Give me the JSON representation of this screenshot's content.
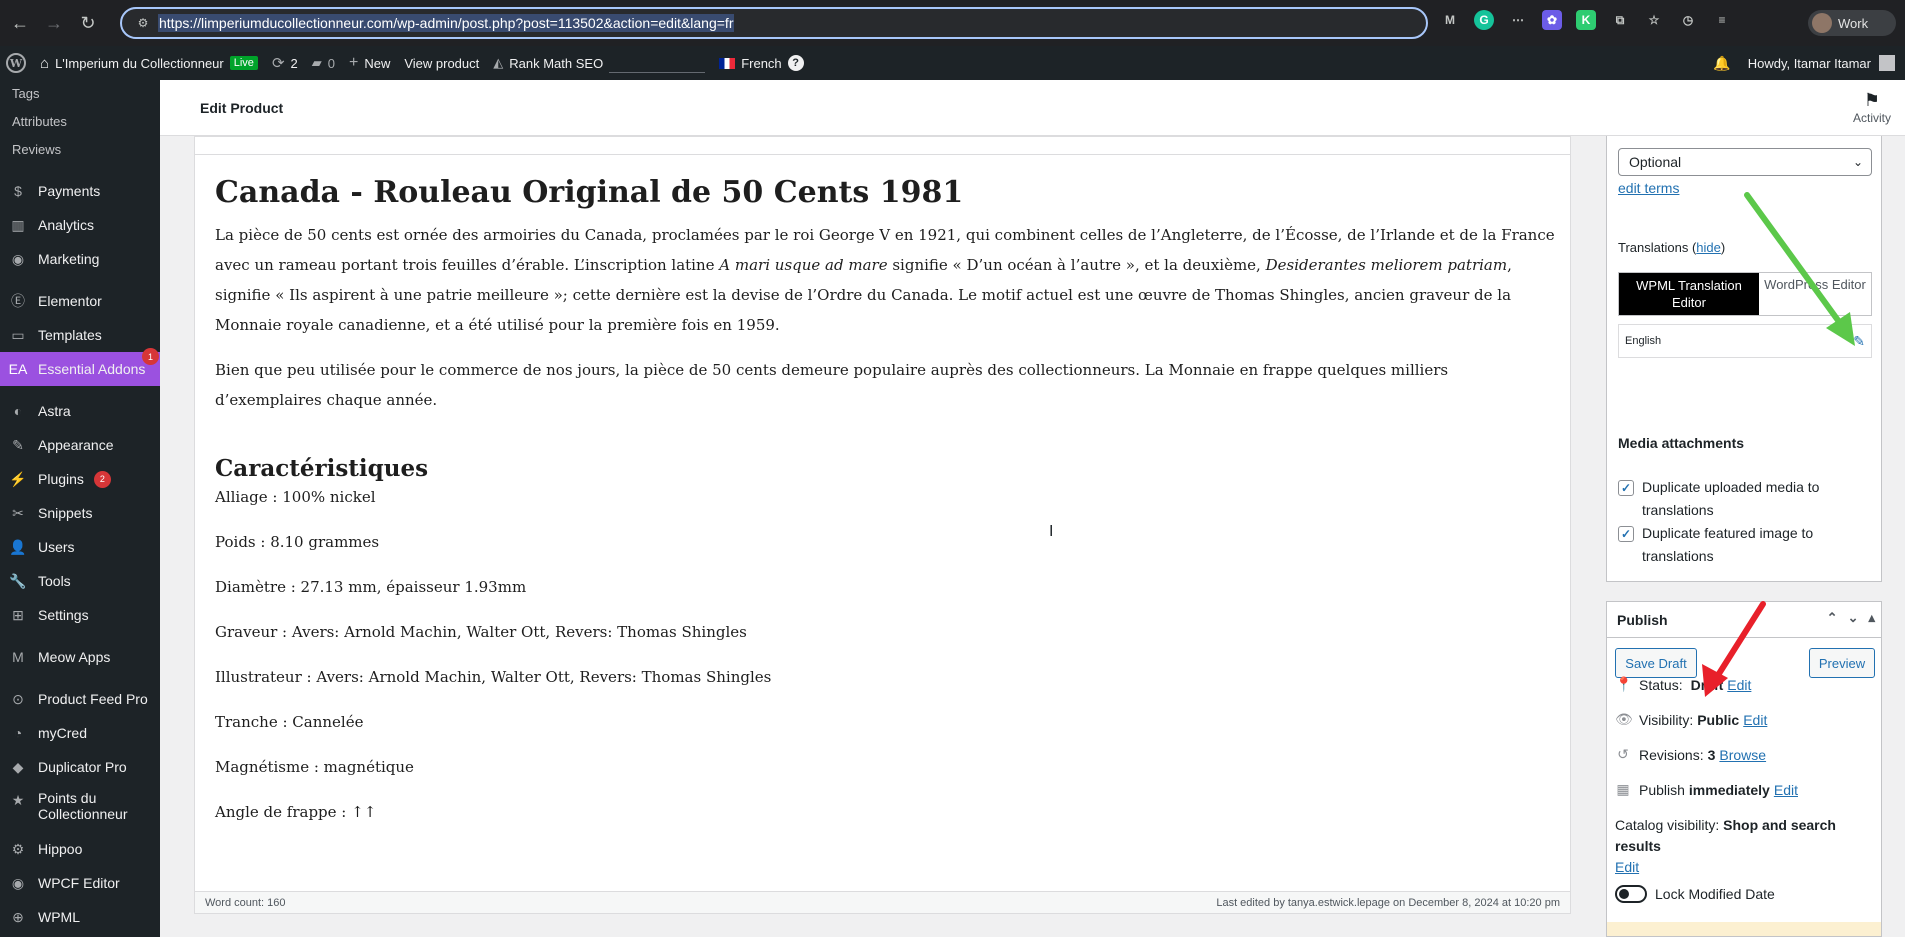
{
  "browser": {
    "url": "https://limperiumducollectionneur.com/wp-admin/post.php?post=113502&action=edit&lang=fr",
    "profile_label": "Work"
  },
  "admin_bar": {
    "site_name": "L'Imperium du Collectionneur",
    "live_label": "Live",
    "updates_count": "2",
    "comments_count": "0",
    "new_label": "New",
    "view_product_label": "View product",
    "rank_math_label": "Rank Math SEO",
    "language_label": "French",
    "howdy_label": "Howdy, Itamar Itamar"
  },
  "sidebar": {
    "sub_items": [
      "Tags",
      "Attributes",
      "Reviews"
    ],
    "items": [
      {
        "label": "Payments",
        "icon": "payments-icon"
      },
      {
        "label": "Analytics",
        "icon": "analytics-icon"
      },
      {
        "label": "Marketing",
        "icon": "marketing-icon"
      },
      {
        "label": "Elementor",
        "icon": "elementor-icon"
      },
      {
        "label": "Templates",
        "icon": "templates-icon"
      },
      {
        "label": "Essential Addons",
        "icon": "essential-addons-icon",
        "badge": "1"
      },
      {
        "label": "Astra",
        "icon": "astra-icon"
      },
      {
        "label": "Appearance",
        "icon": "appearance-icon"
      },
      {
        "label": "Plugins",
        "icon": "plugins-icon",
        "badge": "2"
      },
      {
        "label": "Snippets",
        "icon": "snippets-icon"
      },
      {
        "label": "Users",
        "icon": "users-icon"
      },
      {
        "label": "Tools",
        "icon": "tools-icon"
      },
      {
        "label": "Settings",
        "icon": "settings-icon"
      },
      {
        "label": "Meow Apps",
        "icon": "meow-apps-icon"
      },
      {
        "label": "Product Feed Pro",
        "icon": "product-feed-icon"
      },
      {
        "label": "myCred",
        "icon": "mycred-icon"
      },
      {
        "label": "Duplicator Pro",
        "icon": "duplicator-icon"
      },
      {
        "label": "Points du Collectionneur",
        "icon": "star-icon"
      },
      {
        "label": "Hippoo",
        "icon": "hippoo-icon"
      },
      {
        "label": "WPCF Editor",
        "icon": "wpcf-icon"
      },
      {
        "label": "WPML",
        "icon": "wpml-icon"
      }
    ]
  },
  "header": {
    "title": "Edit Product",
    "activity_label": "Activity"
  },
  "editor": {
    "heading": "Canada - Rouleau Original de 50 Cents 1981",
    "para1_a": "La pièce de 50 cents est ornée des armoiries du Canada, proclamées par le roi George V en 1921, qui combinent celles de l’Angleterre, de l’Écosse, de l’Irlande et de la France avec un rameau portant trois feuilles d’érable. L’inscription latine ",
    "para1_em1": "A mari usque ad mare",
    "para1_b": " signifie « D’un océan à l’autre », et la deuxième, ",
    "para1_em2": "Desiderantes meliorem patriam",
    "para1_c": ", signifie « Ils aspirent à une patrie meilleure »; cette dernière est la devise de l’Ordre du Canada. Le motif actuel est une œuvre de Thomas Shingles, ancien graveur de la Monnaie royale canadienne, et a été utilisé pour la première fois en 1959.",
    "para2": "Bien que peu utilisée pour le commerce de nos jours, la pièce de 50 cents demeure populaire auprès des collectionneurs. La Monnaie en frappe quelques milliers d’exemplaires chaque année.",
    "subheading": "Caractéristiques",
    "specs": [
      "Alliage : 100% nickel",
      "Poids : 8.10 grammes",
      "Diamètre :  27.13 mm, épaisseur 1.93mm",
      "Graveur : Avers: Arnold Machin, Walter Ott, Revers: Thomas Shingles",
      "Illustrateur : Avers: Arnold Machin, Walter Ott, Revers: Thomas Shingles",
      "Tranche : Cannelée",
      "Magnétisme : magnétique",
      "Angle de frappe : ↑↑"
    ],
    "word_count": "Word count: 160",
    "last_edited": "Last edited by tanya.estwick.lepage on December 8, 2024 at 10:20 pm"
  },
  "right_panel": {
    "select_value": "Optional",
    "edit_terms_label": "edit terms",
    "translations_label": "Translations",
    "hide_label": "hide",
    "tab_wpml": "WPML Translation Editor",
    "tab_wp": "WordPress Editor",
    "language_row": "English",
    "media_title": "Media attachments",
    "cb1": "Duplicate uploaded media to translations",
    "cb2": "Duplicate featured image to translations"
  },
  "publish": {
    "title": "Publish",
    "save_draft": "Save Draft",
    "preview": "Preview",
    "status_label": "Status:",
    "status_value": "Draft",
    "visibility_label": "Visibility:",
    "visibility_value": "Public",
    "revisions_label": "Revisions:",
    "revisions_value": "3",
    "browse_label": "Browse",
    "publish_label": "Publish",
    "publish_value": "immediately",
    "catalog_label": "Catalog visibility:",
    "catalog_value": "Shop and search results",
    "edit_label": "Edit",
    "lock_label": "Lock Modified Date"
  },
  "colors": {
    "active_menu": "#9b51e0",
    "green_arrow": "#5cc84a",
    "red_arrow": "#e8202a"
  }
}
